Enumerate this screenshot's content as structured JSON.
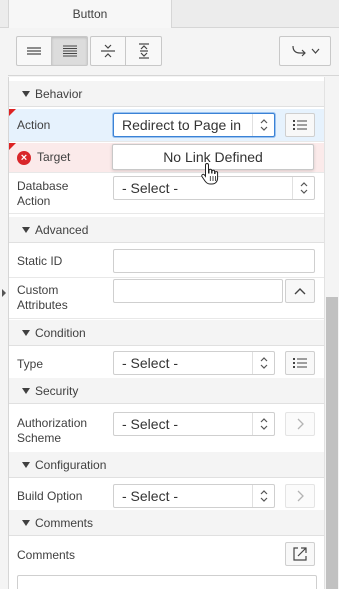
{
  "tabs": [
    {
      "label": "Button"
    }
  ],
  "toolbar": {
    "layout_buttons": [
      {
        "name": "show-common-icon",
        "label": "Show Common",
        "active": false
      },
      {
        "name": "show-all-icon",
        "label": "Show All",
        "active": true
      },
      {
        "name": "collapse-all-icon",
        "label": "Collapse All",
        "active": false
      },
      {
        "name": "expand-all-icon",
        "label": "Expand All",
        "active": false
      }
    ],
    "go_to_group": {
      "icon": "go-to-group-icon"
    }
  },
  "sections": {
    "behavior": "Behavior",
    "advanced": "Advanced",
    "condition": "Condition",
    "security": "Security",
    "configuration": "Configuration",
    "comments": "Comments"
  },
  "fields": {
    "action": {
      "label": "Action",
      "value": "Redirect to Page in"
    },
    "target": {
      "label": "Target",
      "value": "No Link Defined",
      "error": true
    },
    "database_action": {
      "label": "Database Action",
      "label_line1": "Database",
      "label_line2": "Action",
      "value": "- Select -"
    },
    "static_id": {
      "label": "Static ID",
      "value": ""
    },
    "custom_attributes": {
      "label": "Custom Attributes",
      "label_line1": "Custom",
      "label_line2": "Attributes",
      "value": ""
    },
    "type": {
      "label": "Type",
      "value": "- Select -"
    },
    "authorization_scheme": {
      "label": "Authorization Scheme",
      "label_line1": "Authorization",
      "label_line2": "Scheme",
      "value": "- Select -"
    },
    "build_option": {
      "label": "Build Option",
      "value": "- Select -"
    },
    "comments": {
      "label": "Comments",
      "value": ""
    }
  },
  "colors": {
    "error": "#d9262a",
    "selected_row": "#e6f2fd",
    "error_row": "#fbeaea",
    "focus": "#3a82d6"
  }
}
